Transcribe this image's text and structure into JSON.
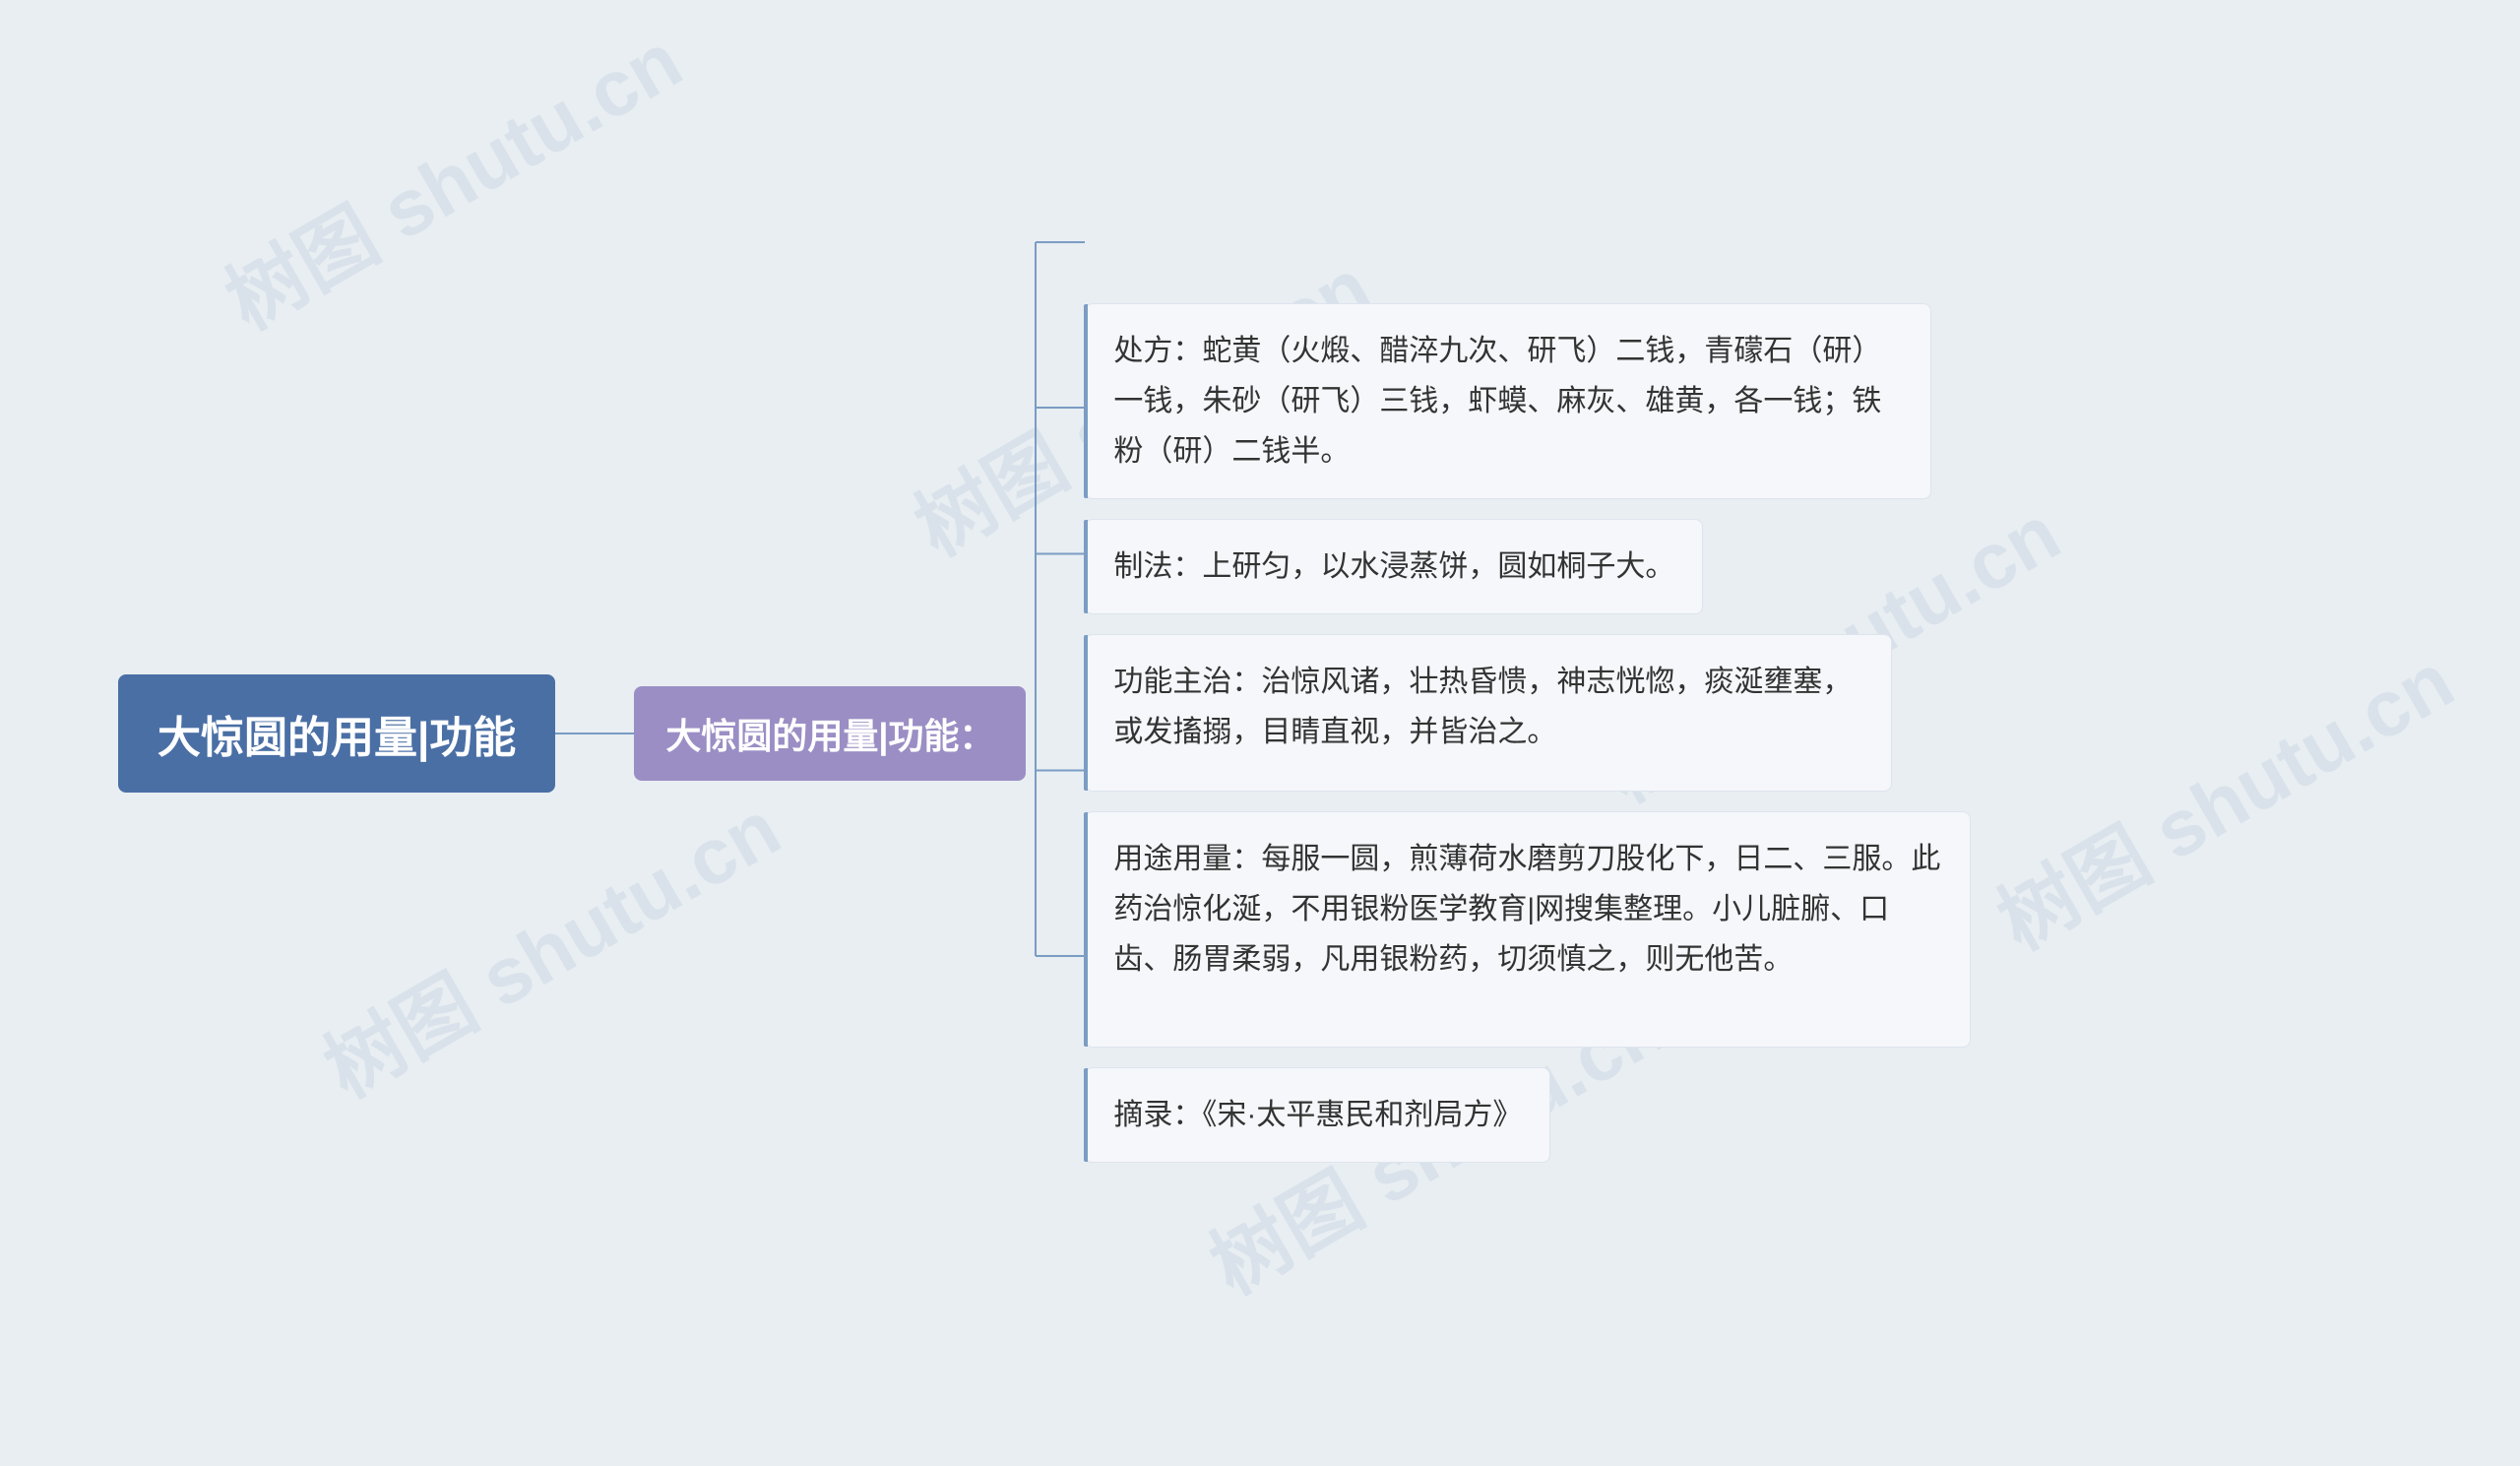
{
  "watermarks": [
    "树图 shutu.cn",
    "树图 shutu.cn",
    "树图 shutu.cn",
    "树图 shutu.cn",
    "树图 shutu.cn",
    "树图 shutu.cn"
  ],
  "root": {
    "label": "大惊圆的用量|功能"
  },
  "mid": {
    "label": "大惊圆的用量|功能："
  },
  "leaves": [
    {
      "id": "leaf1",
      "text": "处方：蛇黄（火煅、醋淬九次、研飞）二钱，青礞石（研）一钱，朱砂（研飞）三钱，虾蟆、麻灰、雄黄，各一钱；铁粉（研）二钱半。"
    },
    {
      "id": "leaf2",
      "text": "制法：上研匀，以水浸蒸饼，圆如桐子大。"
    },
    {
      "id": "leaf3",
      "text": "功能主治：治惊风诸，壮热昏愦，神志恍惚，痰涎壅塞，或发搐搦，目睛直视，并皆治之。"
    },
    {
      "id": "leaf4",
      "text": "用途用量：每服一圆，煎薄荷水磨剪刀股化下，日二、三服。此药治惊化涎，不用银粉医学教育|网搜集整理。小儿脏腑、口齿、肠胃柔弱，凡用银粉药，切须慎之，则无他苦。"
    },
    {
      "id": "leaf5",
      "text": "摘录：《宋·太平惠民和剂局方》"
    }
  ],
  "colors": {
    "root_bg": "#4a6fa5",
    "mid_bg": "#9b8ec4",
    "leaf_bg": "#f5f7fa",
    "connector": "#7b9cc4",
    "text_light": "#ffffff",
    "text_dark": "#333333",
    "body_bg": "#e8eef2"
  }
}
